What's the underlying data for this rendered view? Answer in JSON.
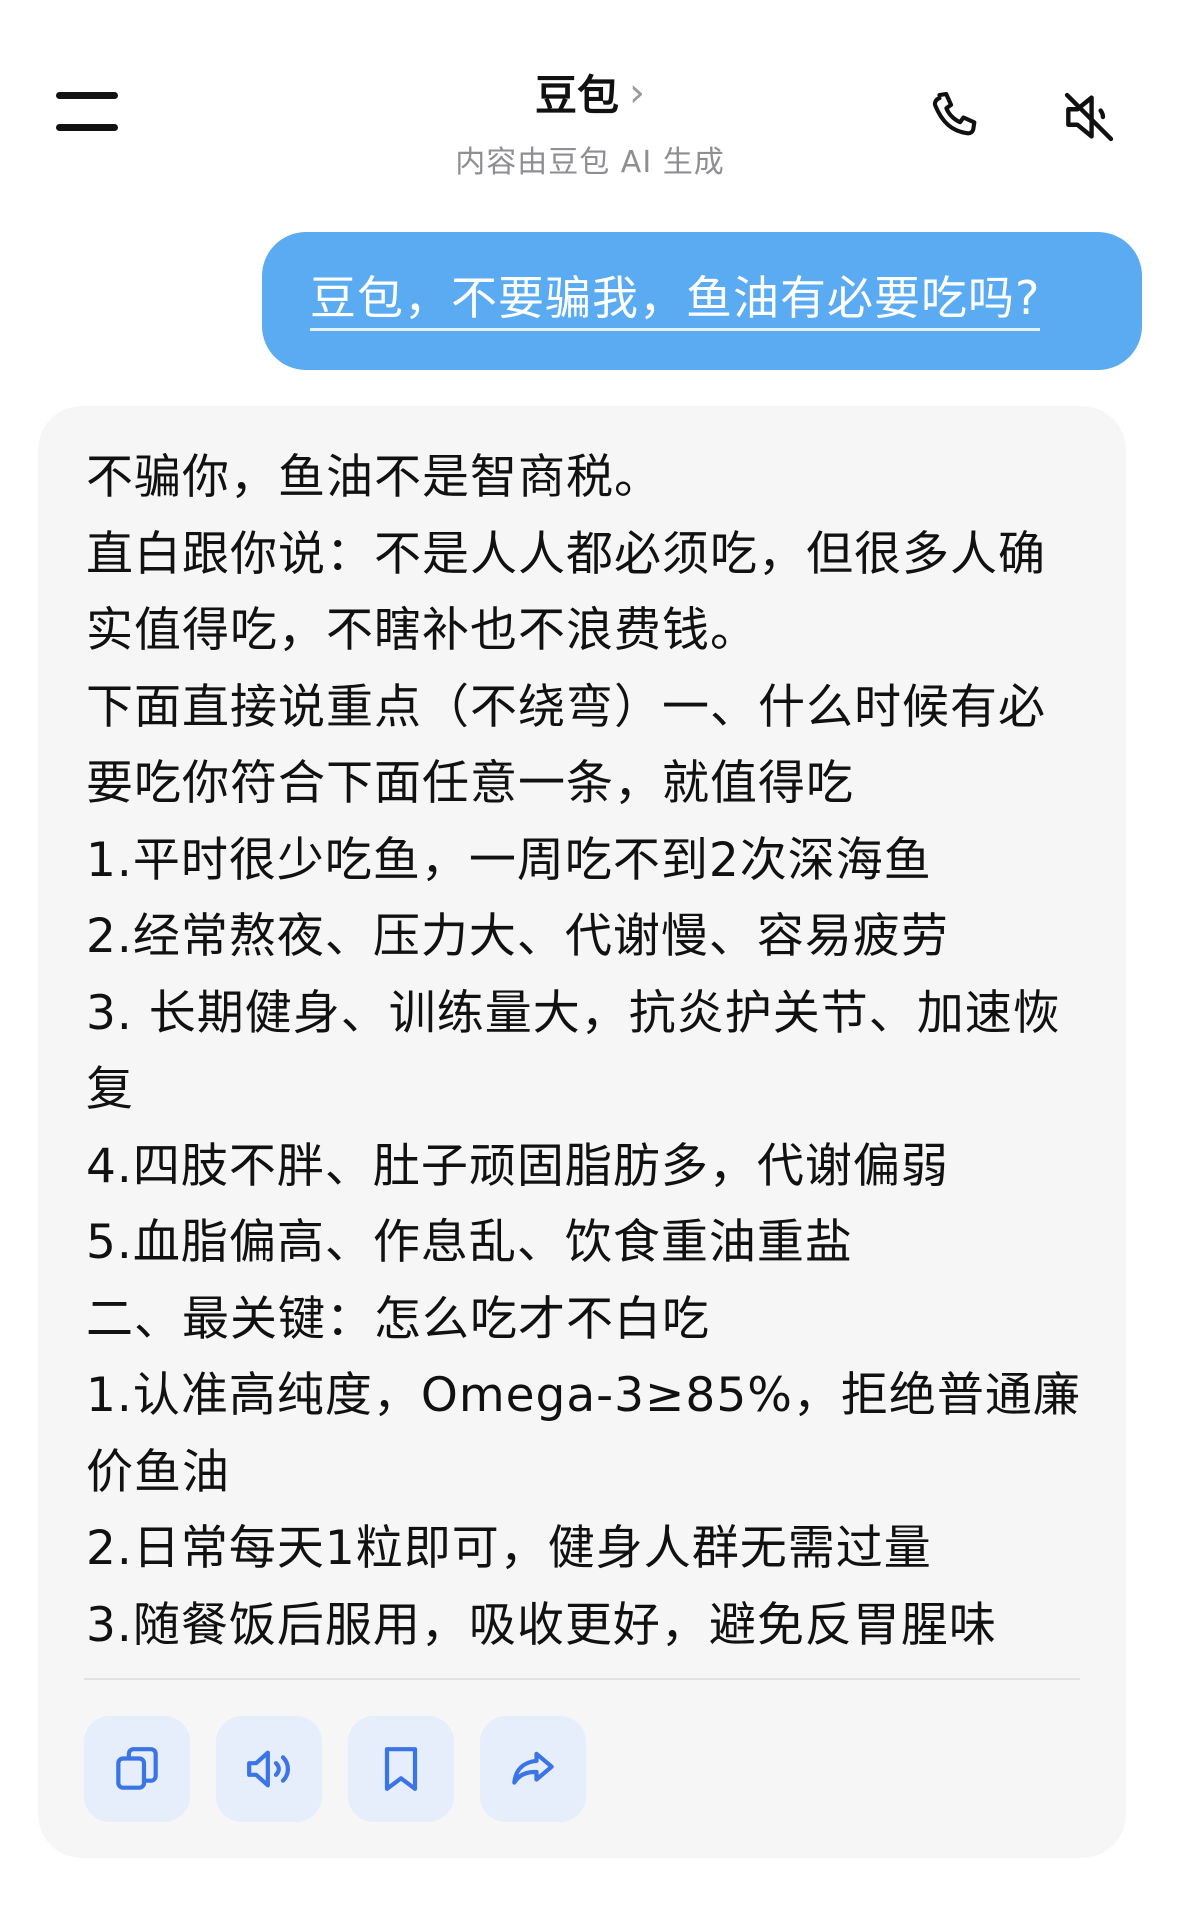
{
  "header": {
    "title": "豆包",
    "chevron": "›",
    "subtitle": "内容由豆包 AI 生成",
    "icons": [
      "menu-icon",
      "phone-icon",
      "speaker-muted-icon"
    ]
  },
  "conversation": {
    "user_message": "豆包，不要骗我，鱼油有必要吃吗?",
    "ai_reply_lines": [
      "不骗你，鱼油不是智商税。",
      "直白跟你说：不是人人都必须吃，但很多人确实值得吃，不瞎补也不浪费钱。",
      "下面直接说重点（不绕弯）一、什么时候有必要吃你符合下面任意一条，就值得吃",
      "1.平时很少吃鱼，一周吃不到2次深海鱼",
      "2.经常熬夜、压力大、代谢慢、容易疲劳",
      "3. 长期健身、训练量大，抗炎护关节、加速恢复",
      "4.四肢不胖、肚子顽固脂肪多，代谢偏弱",
      "5.血脂偏高、作息乱、饮食重油重盐",
      "二、最关键：怎么吃才不白吃",
      "1.认准高纯度，Omega-3≥85%，拒绝普通廉价鱼油",
      "2.日常每天1粒即可，健身人群无需过量",
      "3.随餐饭后服用，吸收更好，避免反胃腥味"
    ]
  },
  "actions": {
    "icons": [
      "copy-icon",
      "speaker-icon",
      "bookmark-icon",
      "share-icon"
    ],
    "accent_color": "#3b74e6"
  },
  "colors": {
    "user_bubble": "#5aabf2",
    "ai_card": "#f6f6f6",
    "action_bg": "#e6edfb"
  }
}
